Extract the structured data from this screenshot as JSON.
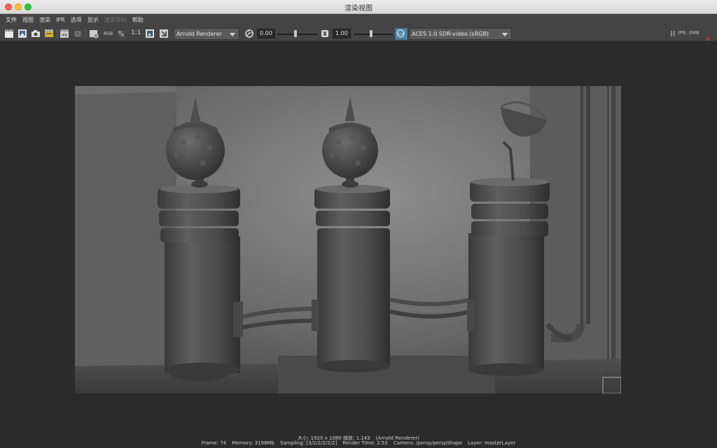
{
  "window": {
    "title": "渲染视图"
  },
  "menu": [
    {
      "label": "文件",
      "enabled": true
    },
    {
      "label": "视图",
      "enabled": true
    },
    {
      "label": "渲染",
      "enabled": true
    },
    {
      "label": "IPR",
      "enabled": true
    },
    {
      "label": "选项",
      "enabled": true
    },
    {
      "label": "显示",
      "enabled": true
    },
    {
      "label": "渲染目标",
      "enabled": false
    },
    {
      "label": "帮助",
      "enabled": true
    }
  ],
  "toolbar": {
    "rgb_label": "RGB",
    "ratio_label": "1:1",
    "renderer": "Arnold Renderer",
    "exposure_value": "0.00",
    "gamma_value": "1.00",
    "exposure_slider": 0.45,
    "gamma_slider": 0.45,
    "ocio_label": "OCIO",
    "view_transform": "ACES 1.0 SDR-video (sRGB)",
    "ipr_memory": "IPR: 0MB"
  },
  "status": {
    "size_line": "大小: 1920 x 1080 缩放: 1.143",
    "renderer_line": "(Arnold Renderer)",
    "frame": "Frame: 74",
    "memory": "Memory: 3198Mb",
    "sampling": "Sampling: [3/2/2/2/2/2]",
    "render_time": "Render Time: 2:53",
    "camera": "Camera: /persp/perspShape",
    "layer": "Layer: masterLayer"
  },
  "colors": {
    "close": "#fe5f57",
    "minimize": "#febc2e",
    "maximize": "#28c840",
    "ocio_accent": "#5285a6",
    "background": "#2b2b2b",
    "toolbar": "#444444"
  }
}
